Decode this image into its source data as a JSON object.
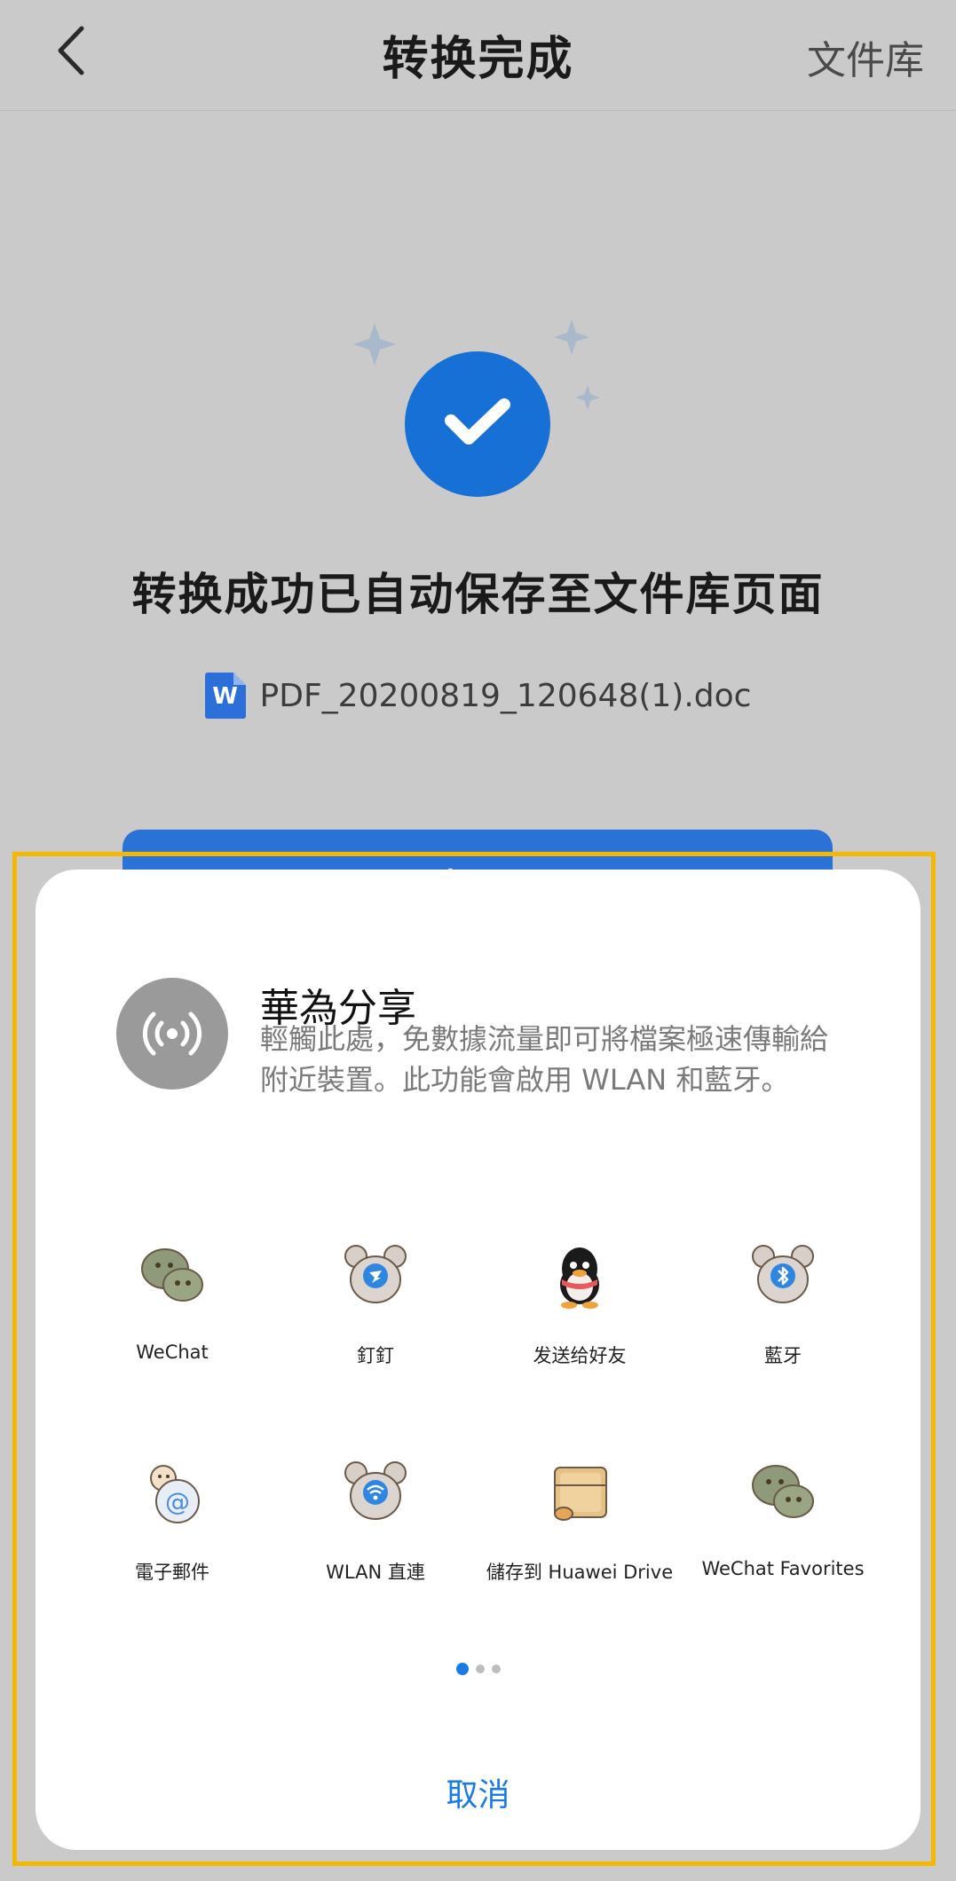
{
  "header": {
    "title": "转换完成",
    "right_link": "文件库"
  },
  "result": {
    "message": "转换成功已自动保存至文件库页面",
    "file_name": "PDF_20200819_120648(1).doc",
    "file_icon_letter": "W",
    "primary_button": "打开"
  },
  "share_sheet": {
    "huawei_share": {
      "title": "華為分享",
      "description": "輕觸此處，免數據流量即可將檔案極速傳輸給附近裝置。此功能會啟用 WLAN 和藍牙。"
    },
    "apps": [
      {
        "label": "WeChat",
        "icon": "wechat-icon"
      },
      {
        "label": "釘釘",
        "icon": "dingtalk-icon"
      },
      {
        "label": "发送给好友",
        "icon": "qq-icon"
      },
      {
        "label": "藍牙",
        "icon": "bluetooth-icon"
      },
      {
        "label": "電子郵件",
        "icon": "email-icon"
      },
      {
        "label": "WLAN 直連",
        "icon": "wlan-direct-icon"
      },
      {
        "label": "儲存到 Huawei Drive",
        "icon": "huawei-drive-icon"
      },
      {
        "label": "WeChat Favorites",
        "icon": "wechat-favorites-icon"
      }
    ],
    "page_indicator": {
      "current": 1,
      "total": 3
    },
    "cancel_label": "取消"
  },
  "colors": {
    "accent": "#1a7be6",
    "check_circle": "#1670d6",
    "highlight": "#f5b800"
  }
}
